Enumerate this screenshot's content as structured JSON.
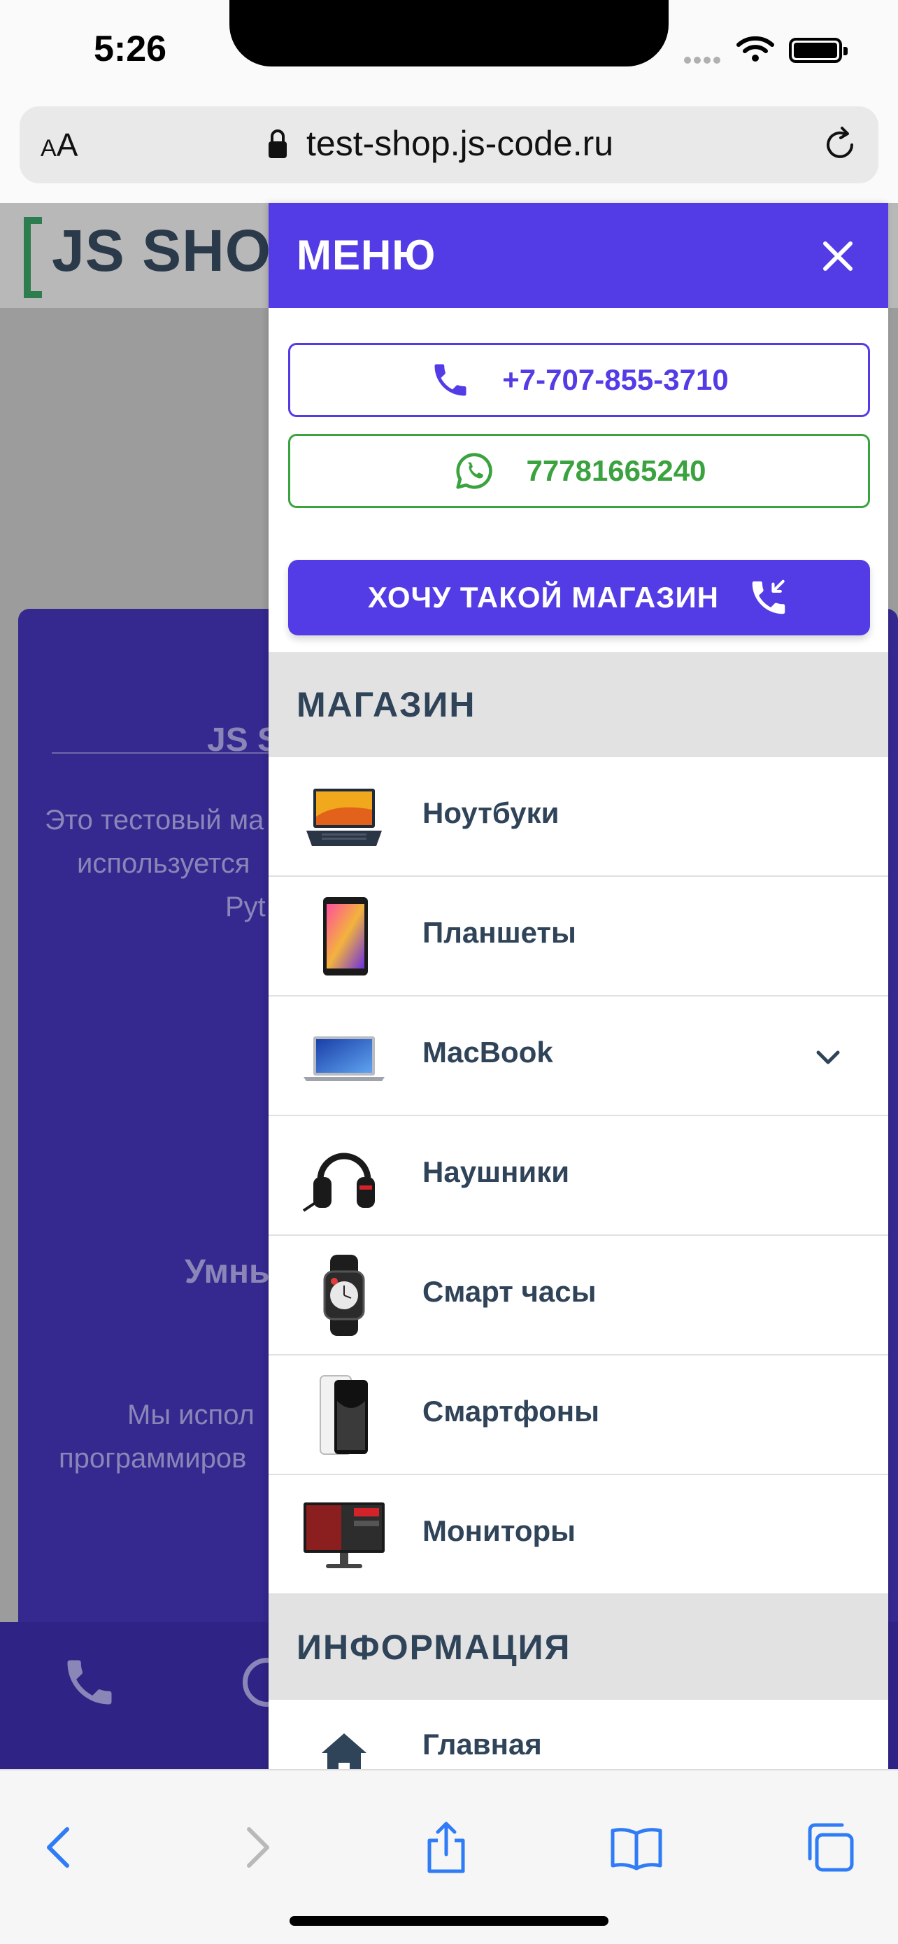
{
  "status_bar": {
    "time": "5:26"
  },
  "address_bar": {
    "text_size_label": "AA",
    "url": "test-shop.js-code.ru"
  },
  "background_page": {
    "logo": "JS SHOP",
    "hero_title": "JS SI",
    "hero_lines": [
      "Это тестовый ма",
      "используется",
      "Pyt"
    ],
    "hero_subtitle": "Умны",
    "hero_lines_2": [
      "Мы испол",
      "программиров"
    ]
  },
  "drawer": {
    "title": "МЕНЮ",
    "phone": "+7-707-855-3710",
    "whatsapp": "77781665240",
    "want_shop_button": "ХОЧУ ТАКОЙ МАГАЗИН",
    "sections": [
      {
        "title": "МАГАЗИН",
        "items": [
          {
            "label": "Ноутбуки",
            "icon": "laptop-thumb"
          },
          {
            "label": "Планшеты",
            "icon": "tablet-thumb"
          },
          {
            "label": "MacBook",
            "icon": "macbook-thumb",
            "expandable": true
          },
          {
            "label": "Наушники",
            "icon": "headphones-thumb"
          },
          {
            "label": "Смарт часы",
            "icon": "smartwatch-thumb"
          },
          {
            "label": "Смартфоны",
            "icon": "smartphone-thumb"
          },
          {
            "label": "Мониторы",
            "icon": "monitor-thumb"
          }
        ]
      },
      {
        "title": "ИНФОРМАЦИЯ",
        "items": [
          {
            "label": "Главная",
            "icon": "home-icon"
          }
        ]
      }
    ]
  },
  "colors": {
    "accent": "#533ce6",
    "whatsapp": "#3aa33f",
    "text_dark": "#2f4359",
    "hero_bg": "#35288f",
    "ios_blue": "#2f7cf6"
  }
}
